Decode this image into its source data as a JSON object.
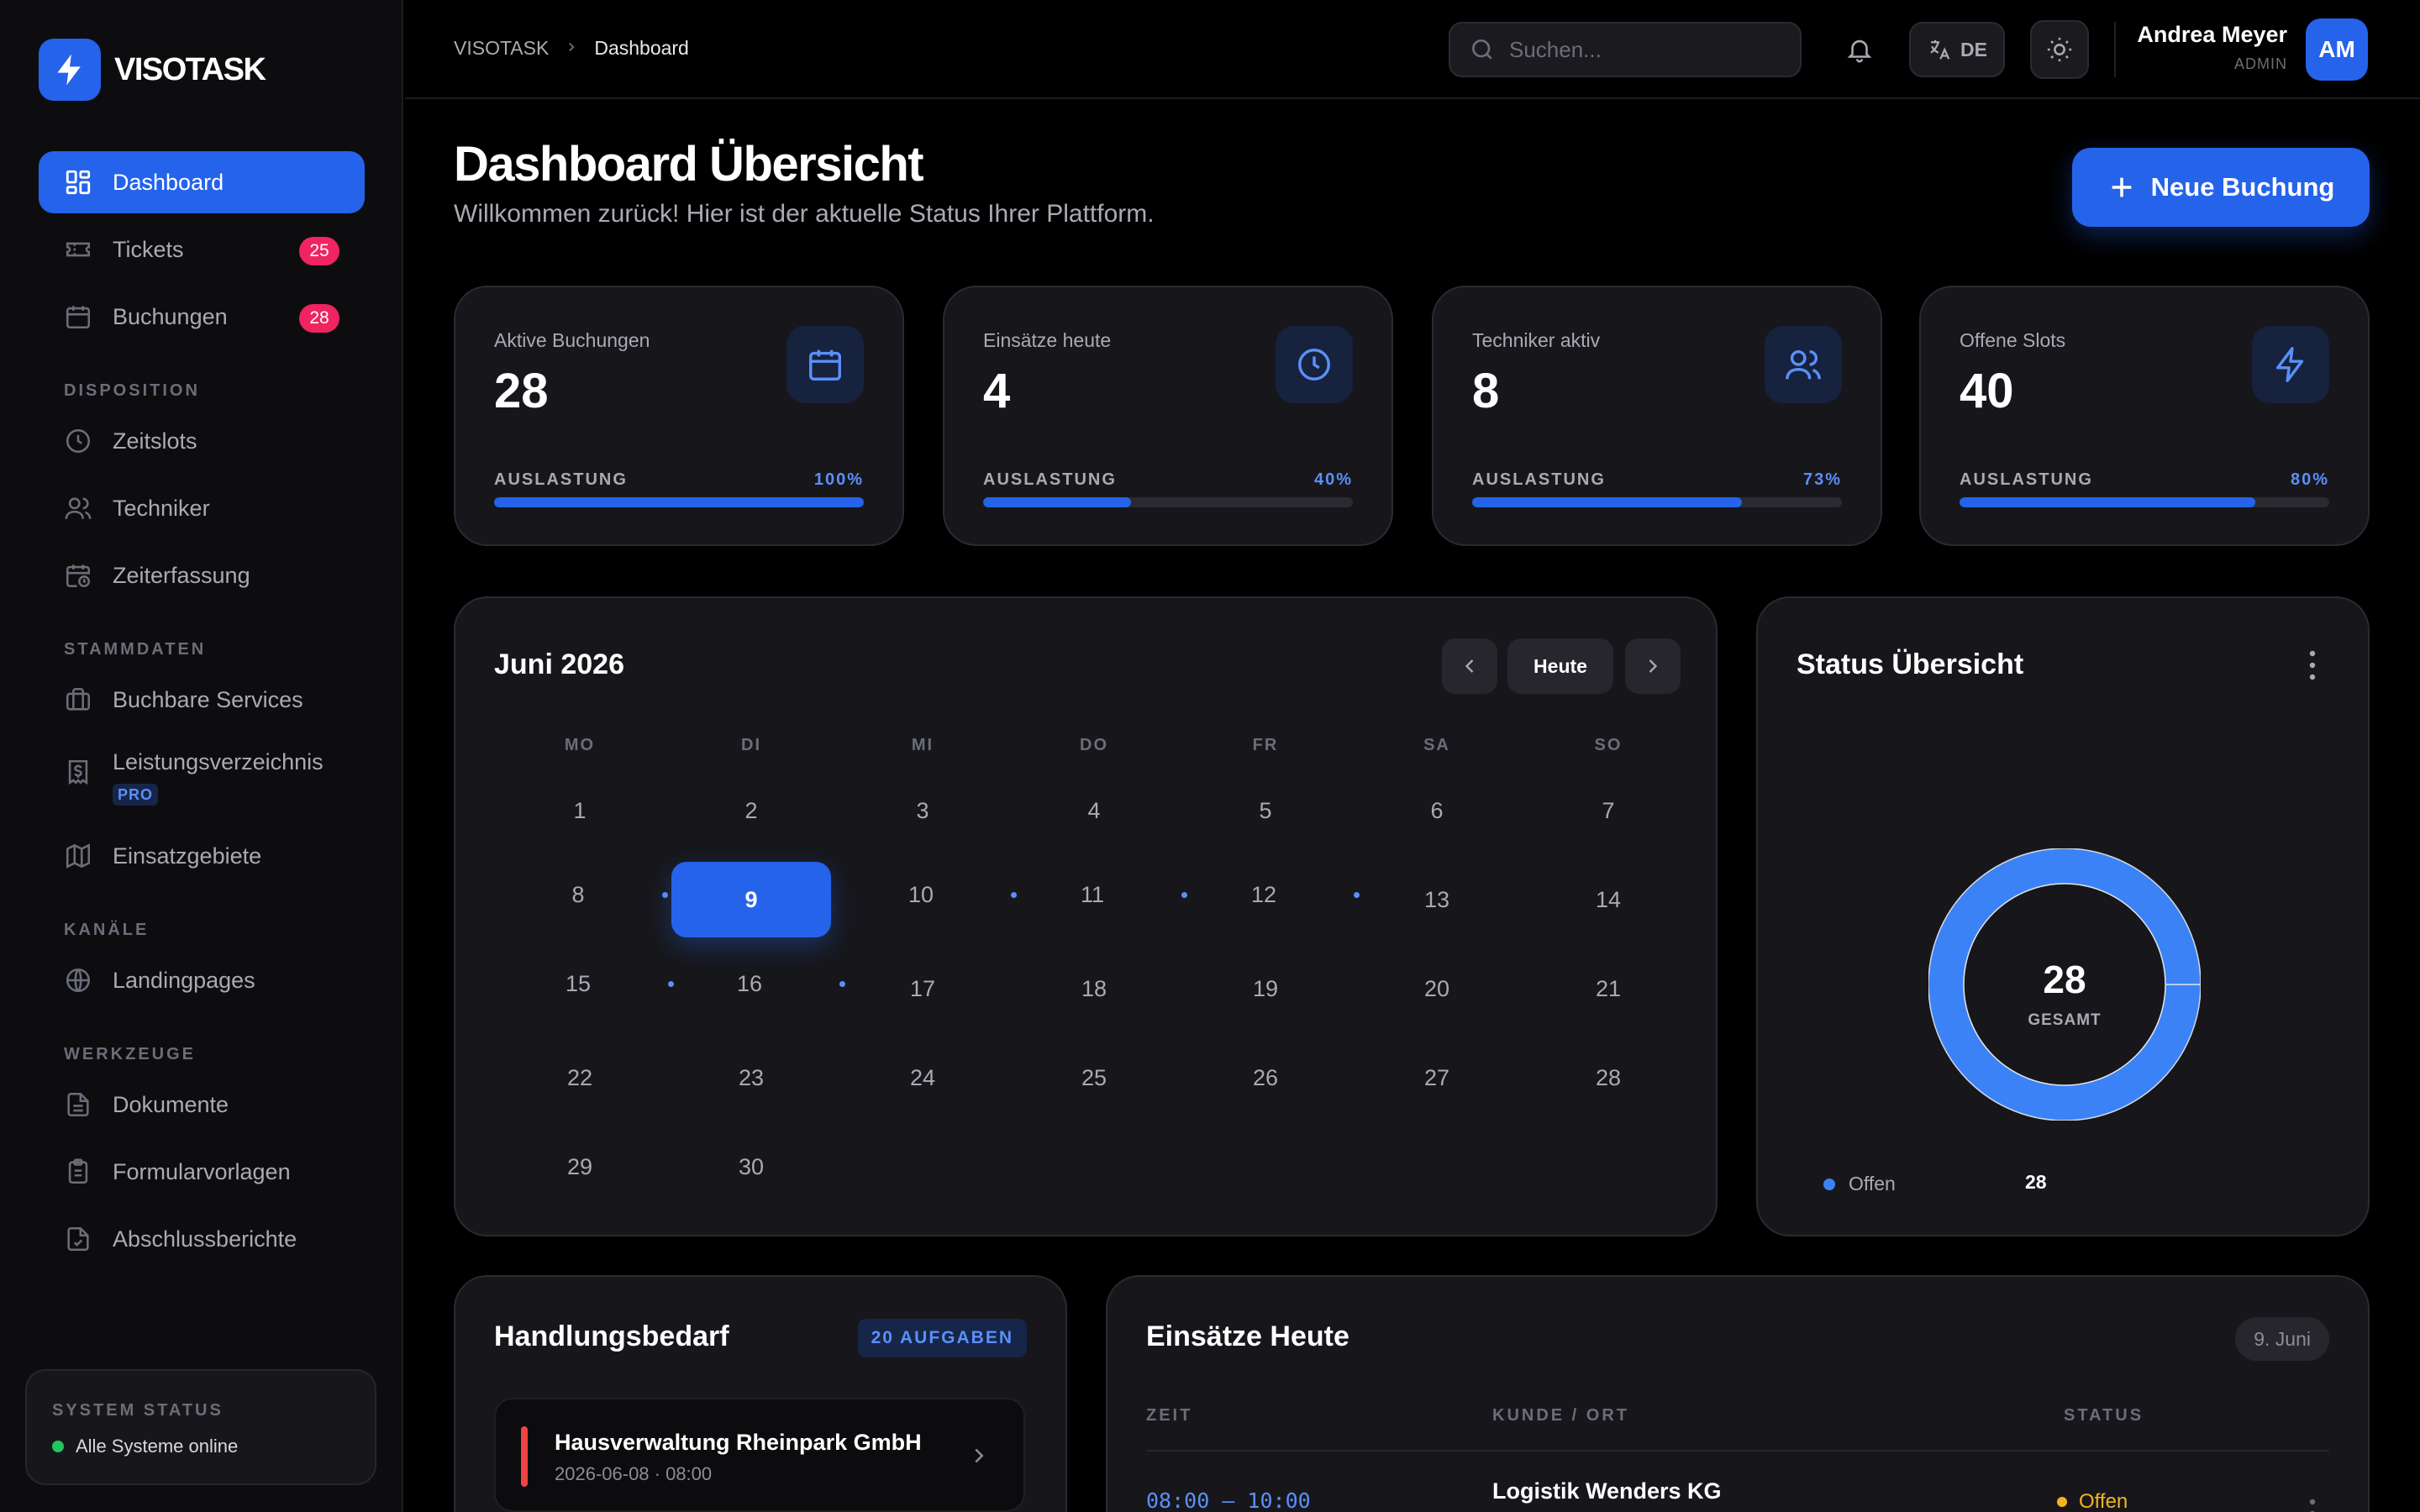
{
  "brand": {
    "name": "VISOTASK"
  },
  "sidebar": {
    "items": [
      {
        "label": "Dashboard",
        "icon": "dashboard-icon",
        "active": true
      },
      {
        "label": "Tickets",
        "icon": "ticket-icon",
        "badge": "25"
      },
      {
        "label": "Buchungen",
        "icon": "calendar-icon",
        "badge": "28"
      }
    ],
    "sections": [
      {
        "title": "DISPOSITION",
        "items": [
          {
            "label": "Zeitslots",
            "icon": "clock-icon"
          },
          {
            "label": "Techniker",
            "icon": "users-icon"
          },
          {
            "label": "Zeiterfassung",
            "icon": "calendar-clock-icon"
          }
        ]
      },
      {
        "title": "STAMMDATEN",
        "items": [
          {
            "label": "Buchbare Services",
            "icon": "briefcase-icon"
          },
          {
            "label": "Leistungsverzeichnis",
            "icon": "receipt-icon",
            "tag": "PRO"
          },
          {
            "label": "Einsatzgebiete",
            "icon": "map-icon"
          }
        ]
      },
      {
        "title": "KANÄLE",
        "items": [
          {
            "label": "Landingpages",
            "icon": "globe-icon"
          }
        ]
      },
      {
        "title": "WERKZEUGE",
        "items": [
          {
            "label": "Dokumente",
            "icon": "file-icon"
          },
          {
            "label": "Formularvorlagen",
            "icon": "clipboard-icon"
          },
          {
            "label": "Abschlussberichte",
            "icon": "file-check-icon"
          }
        ]
      }
    ],
    "system_status": {
      "label": "SYSTEM STATUS",
      "text": "Alle Systeme online"
    }
  },
  "topbar": {
    "breadcrumb": [
      "VISOTASK",
      "Dashboard"
    ],
    "search_placeholder": "Suchen...",
    "language": "DE",
    "user": {
      "name": "Andrea Meyer",
      "role": "ADMIN",
      "initials": "AM"
    }
  },
  "header": {
    "title": "Dashboard Übersicht",
    "subtitle": "Willkommen zurück! Hier ist der aktuelle Status Ihrer Plattform.",
    "primary_action": "Neue Buchung"
  },
  "stats": [
    {
      "label": "Aktive Buchungen",
      "value": "28",
      "util_label": "AUSLASTUNG",
      "percent": "100%",
      "fraction": 1.0,
      "icon": "calendar-icon"
    },
    {
      "label": "Einsätze heute",
      "value": "4",
      "util_label": "AUSLASTUNG",
      "percent": "40%",
      "fraction": 0.4,
      "icon": "clock-icon"
    },
    {
      "label": "Techniker aktiv",
      "value": "8",
      "util_label": "AUSLASTUNG",
      "percent": "73%",
      "fraction": 0.73,
      "icon": "users-icon"
    },
    {
      "label": "Offene Slots",
      "value": "40",
      "util_label": "AUSLASTUNG",
      "percent": "80%",
      "fraction": 0.8,
      "icon": "bolt-icon"
    }
  ],
  "calendar": {
    "month_label": "Juni 2026",
    "today_label": "Heute",
    "weekdays": [
      "MO",
      "DI",
      "MI",
      "DO",
      "FR",
      "SA",
      "SO"
    ],
    "weeks": [
      [
        "1",
        "2",
        "3",
        "4",
        "5",
        "6",
        "7"
      ],
      [
        "8",
        "9",
        "10",
        "11",
        "12",
        "13",
        "14"
      ],
      [
        "15",
        "16",
        "17",
        "18",
        "19",
        "20",
        "21"
      ],
      [
        "22",
        "23",
        "24",
        "25",
        "26",
        "27",
        "28"
      ],
      [
        "29",
        "30",
        "",
        "",
        "",
        "",
        ""
      ]
    ],
    "selected": "9",
    "event_days": [
      "8",
      "10",
      "11",
      "12",
      "15",
      "16"
    ]
  },
  "status_overview": {
    "title": "Status Übersicht",
    "total": "28",
    "total_label": "GESAMT",
    "legend": [
      {
        "label": "Offen",
        "count": "28",
        "color": "#3b82f6"
      }
    ]
  },
  "tasks": {
    "title": "Handlungsbedarf",
    "count_label": "20 AUFGABEN",
    "items": [
      {
        "title": "Hausverwaltung Rheinpark GmbH",
        "subtitle": "2026-06-08 · 08:00"
      }
    ]
  },
  "today_jobs": {
    "title": "Einsätze Heute",
    "date": "9. Juni",
    "columns": [
      "ZEIT",
      "KUNDE / ORT",
      "STATUS"
    ],
    "rows": [
      {
        "time": "08:00 — 10:00",
        "client": "Logistik Wenders KG",
        "status": "Offen"
      }
    ]
  },
  "colors": {
    "accent": "#2563eb",
    "badge": "#f0245f",
    "warning": "#f5b324",
    "danger": "#ef4444",
    "success": "#22c55e"
  }
}
